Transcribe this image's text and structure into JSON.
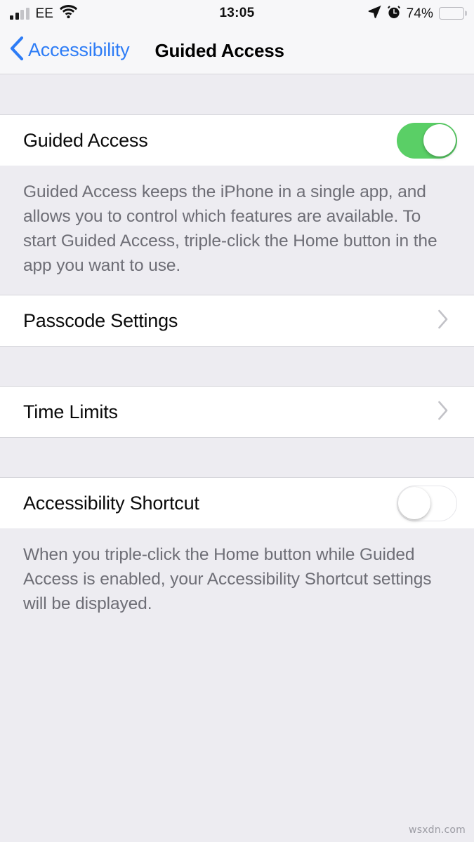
{
  "status_bar": {
    "carrier": "EE",
    "time": "13:05",
    "battery_percent": "74%",
    "battery_level": 74,
    "signal_bars_filled": 2,
    "signal_bars_total": 4,
    "icons": [
      "signal-bars-icon",
      "wifi-icon",
      "location-arrow-icon",
      "alarm-clock-icon",
      "battery-icon"
    ]
  },
  "nav_bar": {
    "back_label": "Accessibility",
    "title": "Guided Access"
  },
  "sections": {
    "guided_access": {
      "row_label": "Guided Access",
      "toggle_state": "on",
      "footnote": "Guided Access keeps the iPhone in a single app, and allows you to control which features are available. To start Guided Access, triple-click the Home button in the app you want to use."
    },
    "passcode": {
      "row_label": "Passcode Settings"
    },
    "time_limits": {
      "row_label": "Time Limits"
    },
    "accessibility_shortcut": {
      "row_label": "Accessibility Shortcut",
      "toggle_state": "off",
      "footnote": "When you triple-click the Home button while Guided Access is enabled, your Accessibility Shortcut settings will be displayed."
    }
  },
  "watermark": "wsxdn.com",
  "colors": {
    "accent_blue": "#2D7CF6",
    "toggle_on_green": "#5ACF66",
    "page_background": "#EDECF1",
    "row_background": "#FFFFFF",
    "footnote_text": "#6E6E76",
    "separator": "#D6D6DB"
  }
}
